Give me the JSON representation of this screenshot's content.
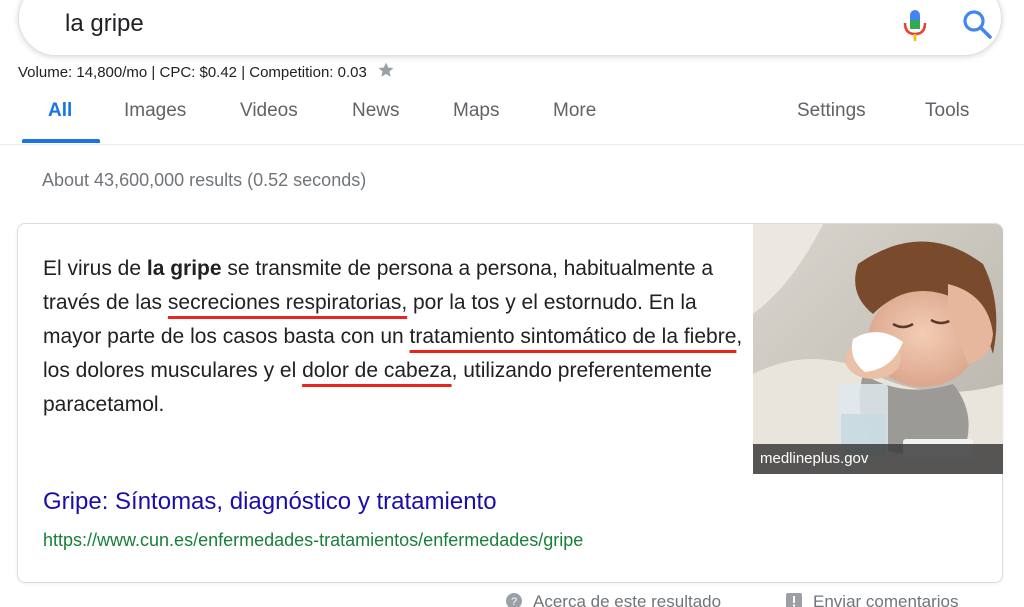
{
  "search": {
    "query": "la gripe"
  },
  "keyword_stats": {
    "text": "Volume: 14,800/mo | CPC: $0.42 | Competition: 0.03"
  },
  "tabs": [
    {
      "label": "All",
      "active": true
    },
    {
      "label": "Images"
    },
    {
      "label": "Videos"
    },
    {
      "label": "News"
    },
    {
      "label": "Maps"
    },
    {
      "label": "More"
    }
  ],
  "tools": {
    "settings_label": "Settings",
    "tools_label": "Tools"
  },
  "result_stats": "About 43,600,000 results (0.52 seconds)",
  "snippet": {
    "t1": "El virus de ",
    "bold": "la gripe",
    "t2": " se transmite de persona a persona, habitualmente a través de las ",
    "hl1": "secreciones respiratorias,",
    "t3": " por la tos y el estornudo. En la mayor parte de los casos basta con un ",
    "hl2": "tratamiento sintomático de la fiebre",
    "t4": ", los dolores musculares y el ",
    "hl3": "dolor de cabeza",
    "t5": ", utilizando preferentemente paracetamol.",
    "image_caption": "medlineplus.gov",
    "result_title": "Gripe: Síntomas, diagnóstico y tratamiento",
    "result_url": "https://www.cun.es/enfermedades-tratamientos/enfermedades/gripe"
  },
  "footer": {
    "about_label": "Acerca de este resultado",
    "feedback_label": "Enviar comentarios"
  },
  "colors": {
    "accent": "#1a73e8",
    "link": "#1a0dab",
    "url": "#188038",
    "highlight_underline": "#e8261d"
  }
}
